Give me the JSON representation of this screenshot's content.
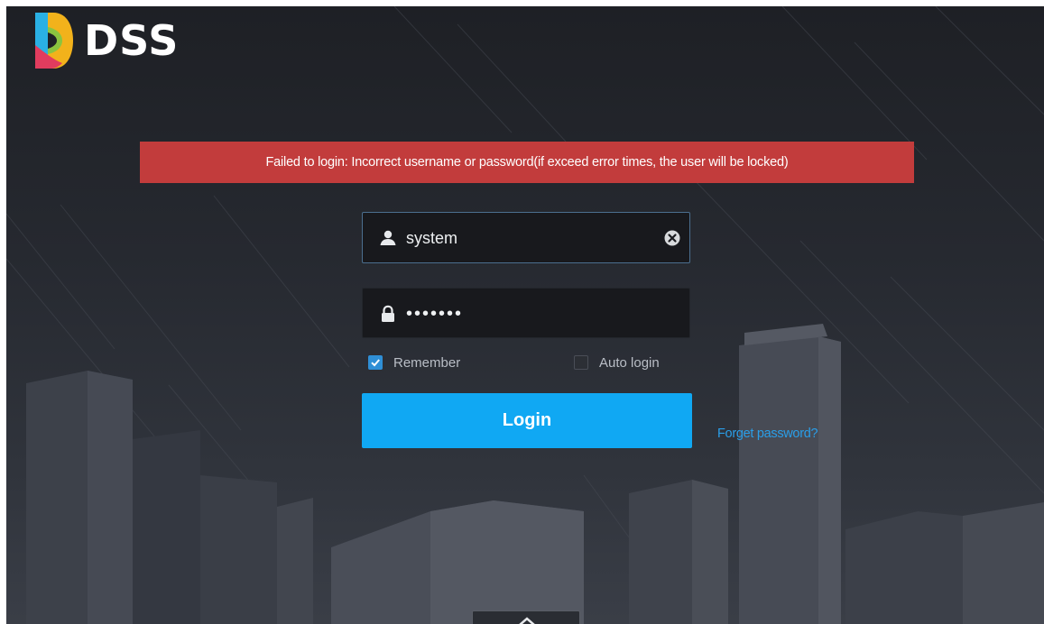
{
  "brand": {
    "name": "DSS",
    "colors": {
      "mark_top": "#f2b21b",
      "mark_left": "#2ab0e4",
      "mark_bottom": "#e13c5e",
      "mark_accent": "#8bc43f"
    }
  },
  "error_banner": {
    "text": "Failed to login: Incorrect username or password(if exceed error times, the user will be locked)",
    "color": "#c23c3c"
  },
  "form": {
    "username": {
      "value": "system",
      "icon": "user-icon",
      "clear_icon": "clear-icon"
    },
    "password": {
      "value": "•••••••",
      "icon": "lock-icon"
    },
    "remember": {
      "label": "Remember",
      "checked": true
    },
    "auto_login": {
      "label": "Auto login",
      "checked": false
    },
    "login_label": "Login",
    "forget_label": "Forget password?",
    "accent": "#10a8f3"
  }
}
